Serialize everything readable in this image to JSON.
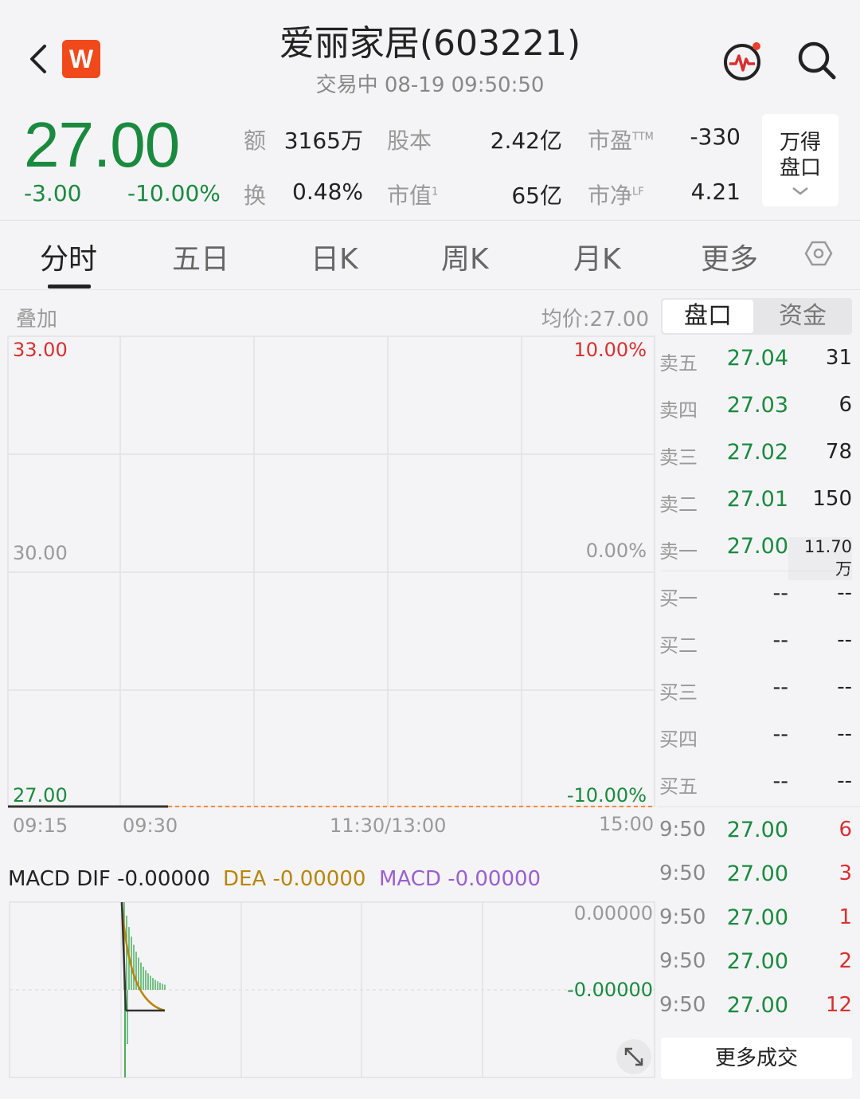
{
  "header": {
    "title": "爱丽家居(603221)",
    "subtitle": "交易中  08-19 09:50:50",
    "logo_letter": "W"
  },
  "quote": {
    "price": "27.00",
    "change": "-3.00",
    "change_pct": "-10.00%",
    "color_down": "#1a8a3e",
    "color_up": "#d83030",
    "stats": {
      "amount_label": "额",
      "amount": "3165万",
      "shares_label": "股本",
      "shares": "2.42亿",
      "pe_label": "市盈",
      "pe_sup": "TTM",
      "pe": "-330",
      "turnover_label": "换",
      "turnover": "0.48%",
      "mcap_label": "市值",
      "mcap_sup": "1",
      "mcap": "65亿",
      "pb_label": "市净",
      "pb_sup": "LF",
      "pb": "4.21"
    },
    "wind_button": {
      "line1": "万得",
      "line2": "盘口"
    }
  },
  "tabs": [
    "分时",
    "五日",
    "日K",
    "周K",
    "月K",
    "更多"
  ],
  "chart": {
    "overlay_label": "叠加",
    "avg_price": "均价:27.00",
    "y_left": [
      "33.00",
      "30.00",
      "27.00"
    ],
    "y_right": [
      "10.00%",
      "0.00%",
      "-10.00%"
    ],
    "x_labels": [
      "09:15",
      "09:30",
      "11:30/13:00",
      "15:00"
    ]
  },
  "macd": {
    "dif": "MACD DIF -0.00000",
    "dea": "DEA -0.00000",
    "macd": "MACD -0.00000",
    "y_top": "0.00000",
    "y_mid": "-0.00000",
    "dea_color": "#b8860b",
    "macd_color": "#9a5fd0"
  },
  "orderbook": {
    "tab_active": "盘口",
    "tab_other": "资金",
    "asks": [
      {
        "label": "卖五",
        "price": "27.04",
        "vol": "31"
      },
      {
        "label": "卖四",
        "price": "27.03",
        "vol": "6"
      },
      {
        "label": "卖三",
        "price": "27.02",
        "vol": "78"
      },
      {
        "label": "卖二",
        "price": "27.01",
        "vol": "150"
      },
      {
        "label": "卖一",
        "price": "27.00",
        "vol": "11.70万"
      }
    ],
    "bids": [
      {
        "label": "买一",
        "price": "--",
        "vol": "--"
      },
      {
        "label": "买二",
        "price": "--",
        "vol": "--"
      },
      {
        "label": "买三",
        "price": "--",
        "vol": "--"
      },
      {
        "label": "买四",
        "price": "--",
        "vol": "--"
      },
      {
        "label": "买五",
        "price": "--",
        "vol": "--"
      }
    ]
  },
  "trades": [
    {
      "time": "9:50",
      "price": "27.00",
      "vol": "6"
    },
    {
      "time": "9:50",
      "price": "27.00",
      "vol": "3"
    },
    {
      "time": "9:50",
      "price": "27.00",
      "vol": "1"
    },
    {
      "time": "9:50",
      "price": "27.00",
      "vol": "2"
    },
    {
      "time": "9:50",
      "price": "27.00",
      "vol": "12"
    }
  ],
  "more_trades": "更多成交"
}
